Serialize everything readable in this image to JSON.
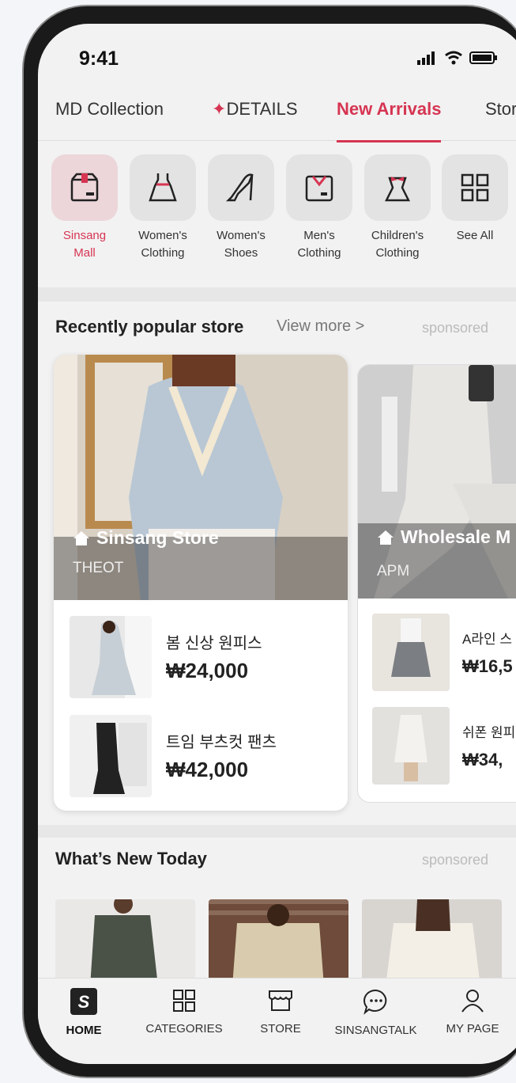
{
  "status": {
    "time": "9:41"
  },
  "tabs": [
    {
      "label": "MD Collection"
    },
    {
      "label": "DETAILS",
      "star": "✦"
    },
    {
      "label": "New Arrivals"
    },
    {
      "label": "Stor"
    }
  ],
  "categories": [
    {
      "label": "Sinsang\nMall",
      "icon": "box-icon"
    },
    {
      "label": "Women's\nClothing",
      "icon": "dress-icon"
    },
    {
      "label": "Women's\nShoes",
      "icon": "heel-icon"
    },
    {
      "label": "Men's\nClothing",
      "icon": "shirt-icon"
    },
    {
      "label": "Children's\nClothing",
      "icon": "kids-clothing-icon"
    },
    {
      "label": "See All",
      "icon": "grid-icon"
    }
  ],
  "popular": {
    "title": "Recently popular store",
    "view_more": "View more >",
    "sponsored": "sponsored",
    "main": {
      "name": "Sinsang Store",
      "sub": "THEOT",
      "products": [
        {
          "name": "봄 신상 원피스",
          "price": "₩24,000"
        },
        {
          "name": "트임 부츠컷 팬츠",
          "price": "₩42,000"
        }
      ]
    },
    "side": {
      "name": "Wholesale M",
      "sub": "APM",
      "products": [
        {
          "name": "A라인 스",
          "price": "₩16,5"
        },
        {
          "name": "쉬폰 원피",
          "price": "₩34,"
        }
      ]
    }
  },
  "whats_new": {
    "title": "What’s New Today",
    "sponsored": "sponsored"
  },
  "bottom_nav": [
    {
      "label": "HOME",
      "icon": "home-logo-icon"
    },
    {
      "label": "CATEGORIES",
      "icon": "grid-icon"
    },
    {
      "label": "STORE",
      "icon": "store-icon"
    },
    {
      "label": "SINSANGTALK",
      "icon": "chat-icon"
    },
    {
      "label": "MY PAGE",
      "icon": "person-icon"
    }
  ],
  "colors": {
    "accent": "#d63552",
    "text": "#222222",
    "muted": "#777777"
  }
}
